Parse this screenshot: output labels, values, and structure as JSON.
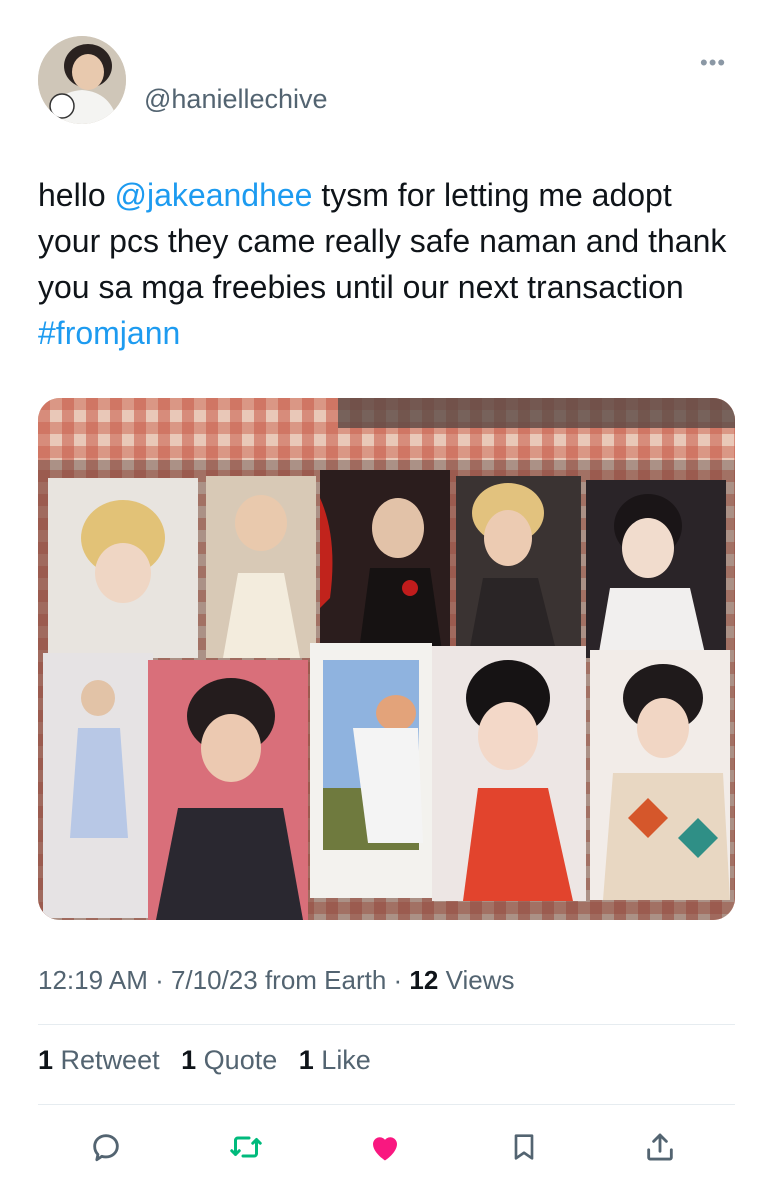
{
  "author": {
    "handle": "@haniellechive"
  },
  "tweet": {
    "parts": [
      {
        "text": "hello ",
        "link": false
      },
      {
        "text": "@jakeandhee",
        "link": true
      },
      {
        "text": " tysm for letting me adopt your pcs they came really safe naman and thank you sa mga freebies until our next transaction ",
        "link": false
      },
      {
        "text": "#fromjann",
        "link": true
      }
    ]
  },
  "meta": {
    "time": "12:19 AM",
    "sep1": " · ",
    "date": "7/10/23",
    "from": " from Earth",
    "sep2": " · ",
    "views_count": "12",
    "views_label": " Views"
  },
  "stats": {
    "retweets_count": "1",
    "retweets_label": "Retweet",
    "quotes_count": "1",
    "quotes_label": "Quote",
    "likes_count": "1",
    "likes_label": "Like"
  },
  "colors": {
    "link": "#1d9bf0",
    "retweet": "#00ba7c",
    "like": "#f91880",
    "icon": "#536471"
  },
  "icons": [
    "more-icon",
    "reply-icon",
    "retweet-icon",
    "like-icon",
    "bookmark-icon",
    "share-icon"
  ]
}
